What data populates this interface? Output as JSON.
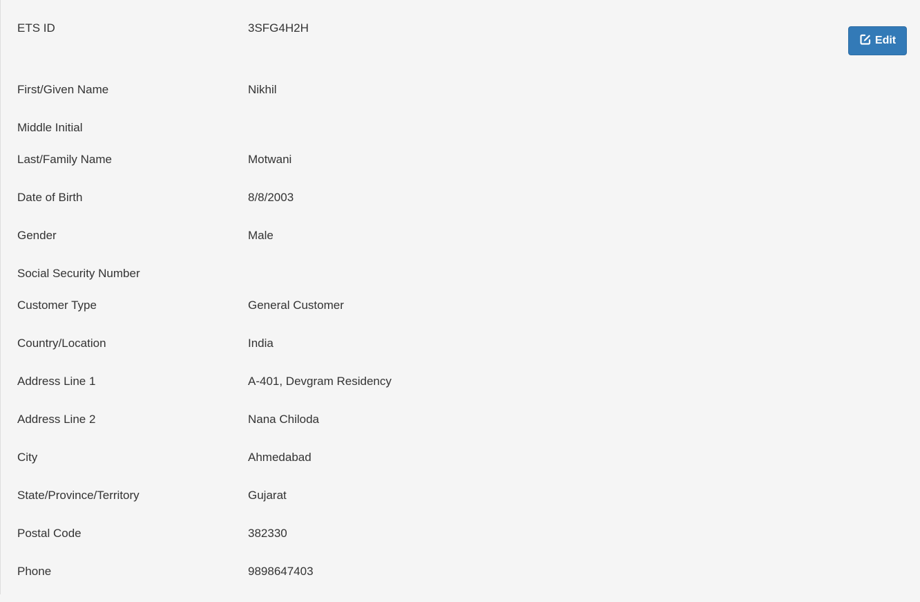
{
  "edit_button": {
    "label": "Edit",
    "icon": "edit-icon",
    "color": "#337ab7"
  },
  "fields": [
    {
      "label": "ETS ID",
      "value": "3SFG4H2H"
    },
    {
      "label": "First/Given Name",
      "value": "Nikhil"
    },
    {
      "label": "Middle Initial",
      "value": ""
    },
    {
      "label": "Last/Family Name",
      "value": "Motwani"
    },
    {
      "label": "Date of Birth",
      "value": "8/8/2003"
    },
    {
      "label": "Gender",
      "value": "Male"
    },
    {
      "label": "Social Security Number",
      "value": ""
    },
    {
      "label": "Customer Type",
      "value": "General Customer"
    },
    {
      "label": "Country/Location",
      "value": "India"
    },
    {
      "label": "Address Line 1",
      "value": "A-401, Devgram Residency"
    },
    {
      "label": "Address Line 2",
      "value": "Nana Chiloda"
    },
    {
      "label": "City",
      "value": "Ahmedabad"
    },
    {
      "label": "State/Province/Territory",
      "value": "Gujarat"
    },
    {
      "label": "Postal Code",
      "value": "382330"
    },
    {
      "label": "Phone",
      "value": "9898647403"
    }
  ]
}
